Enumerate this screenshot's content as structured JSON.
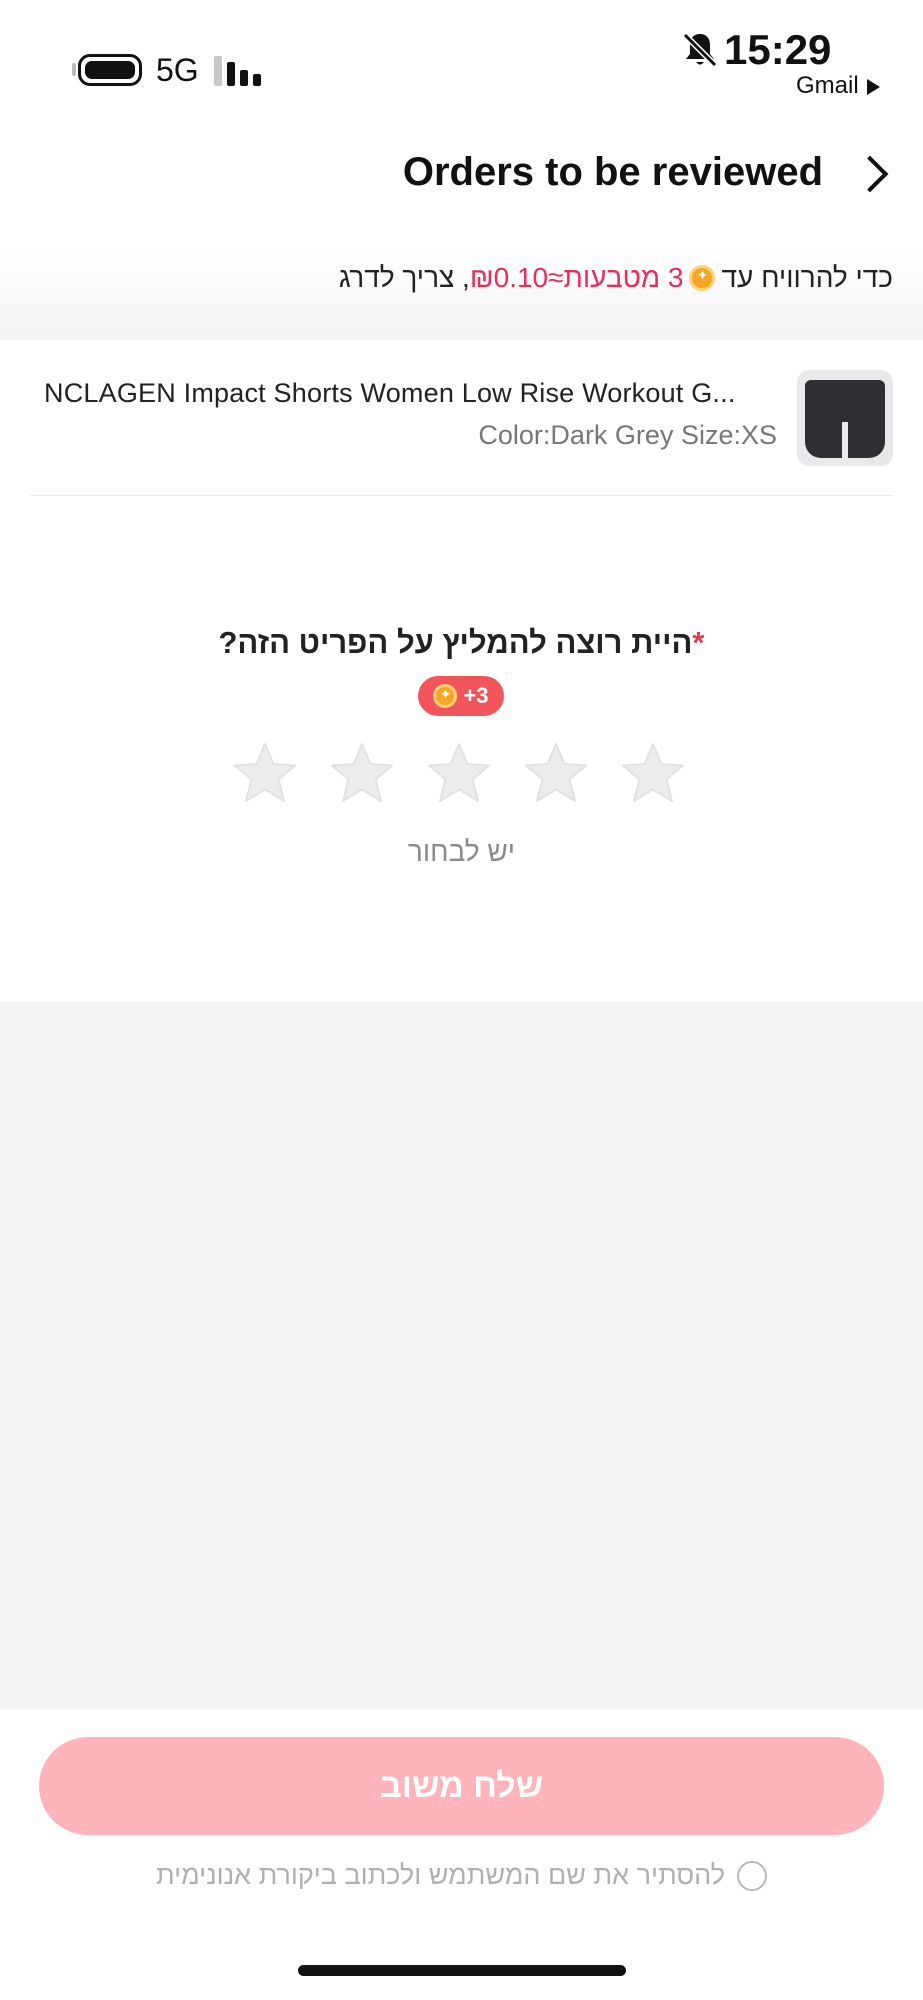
{
  "status_bar": {
    "network": "5G",
    "time": "15:29",
    "back_app": "Gmail",
    "icons": [
      "battery-icon",
      "signal-icon",
      "bell-muted-icon"
    ]
  },
  "header": {
    "title": "Orders to be reviewed",
    "chevron": "chevron-right-icon"
  },
  "promo": {
    "prefix": "כדי להרוויח עד",
    "coins": "3 מטבעות≈₪0.10",
    "suffix": ", צריך לדרג"
  },
  "product": {
    "name": "NCLAGEN Impact Shorts Women Low Rise Workout G...",
    "variant": "Color:Dark Grey Size:XS"
  },
  "rating": {
    "required_mark": "*",
    "question": "היית רוצה להמליץ על הפריט הזה?",
    "reward": "+3",
    "stars_total": 5,
    "stars_selected": 0,
    "hint": "יש לבחור"
  },
  "actions": {
    "submit_label": "שלח משוב",
    "anonymous_label": "להסתיר את שם המשתמש ולכתוב ביקורת אנונימית",
    "anonymous_checked": false
  },
  "colors": {
    "accent": "#e52e5c",
    "badge": "#f2545b",
    "submit_disabled": "#ffb3ba",
    "star_empty": "#ececec",
    "coin": "#f5a623"
  }
}
